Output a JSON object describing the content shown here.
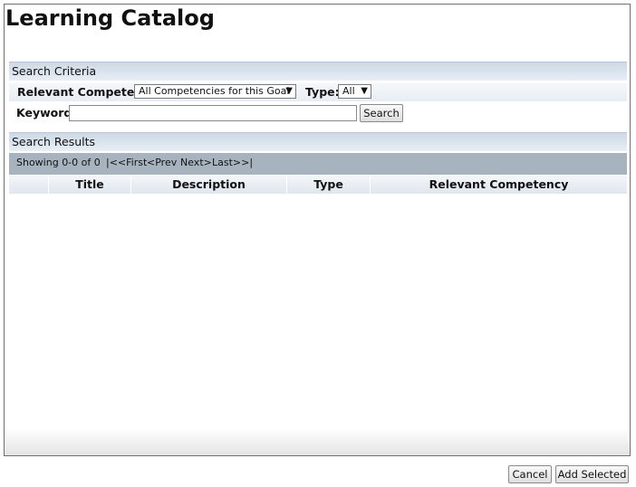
{
  "page": {
    "title": "Learning Catalog"
  },
  "search_criteria": {
    "header": "Search Criteria",
    "competency_label": "Relevant Competency:",
    "competency_value": "All Competencies for this Goal",
    "type_label": "Type:",
    "type_value": "All",
    "keyword_label": "Keyword:",
    "keyword_value": "",
    "search_button": "Search"
  },
  "search_results": {
    "header": "Search Results",
    "showing": "Showing 0-0 of 0",
    "pager": {
      "first": "|<<First",
      "prev": "<Prev",
      "next": "Next>",
      "last": "Last>>|"
    },
    "columns": [
      "",
      "Title",
      "Description",
      "Type",
      "Relevant Competency"
    ],
    "rows": []
  },
  "footer": {
    "cancel_button": "Cancel",
    "add_selected_button": "Add Selected"
  },
  "colors": {
    "section_header": "#dbe4ee",
    "results_bar": "#a7b4bf"
  }
}
